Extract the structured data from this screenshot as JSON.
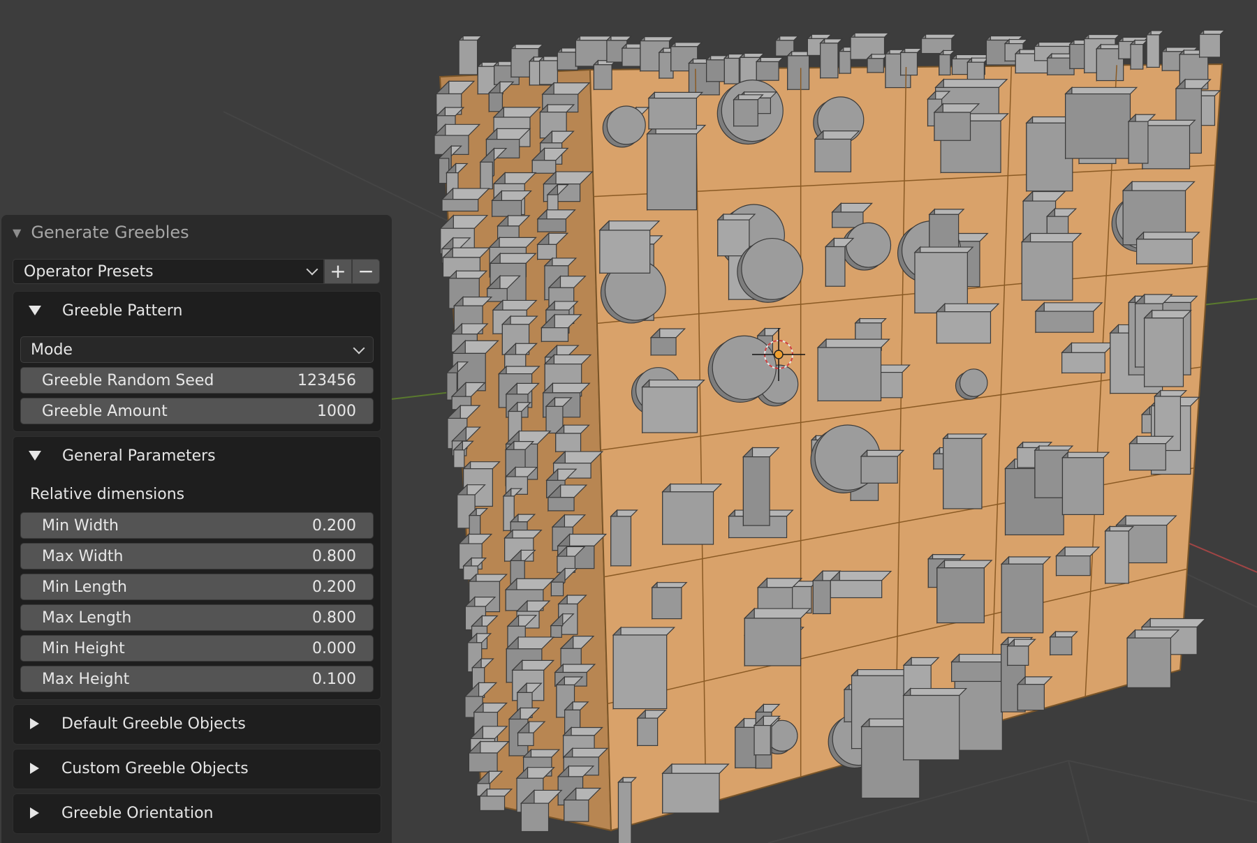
{
  "operator_panel": {
    "title": "Generate Greebles",
    "presets": {
      "label": "Operator Presets",
      "add_label": "+",
      "remove_label": "−"
    },
    "sections": {
      "greeble_pattern": {
        "title": "Greeble Pattern",
        "mode_label": "Mode",
        "fields": [
          {
            "label": "Greeble Random Seed",
            "value": "123456"
          },
          {
            "label": "Greeble Amount",
            "value": "1000"
          }
        ]
      },
      "general_parameters": {
        "title": "General Parameters",
        "subheading": "Relative dimensions",
        "fields": [
          {
            "label": "Min Width",
            "value": "0.200"
          },
          {
            "label": "Max Width",
            "value": "0.800"
          },
          {
            "label": "Min Length",
            "value": "0.200"
          },
          {
            "label": "Max Length",
            "value": "0.800"
          },
          {
            "label": "Min Height",
            "value": "0.000"
          },
          {
            "label": "Max Height",
            "value": "0.100"
          }
        ]
      },
      "default_greeble_objects": {
        "title": "Default Greeble Objects"
      },
      "custom_greeble_objects": {
        "title": "Custom Greeble Objects"
      },
      "greeble_orientation": {
        "title": "Greeble Orientation"
      }
    }
  },
  "colors": {
    "viewport_bg": "#3d3d3d",
    "cube_face": "#d9a26a",
    "greeble": "#9a9a9a",
    "panel_bg": "#2a2a2a",
    "field_bg": "#545454",
    "axis_x": "#a04545",
    "axis_y": "#5a7a2e",
    "origin": "#f0a030"
  }
}
